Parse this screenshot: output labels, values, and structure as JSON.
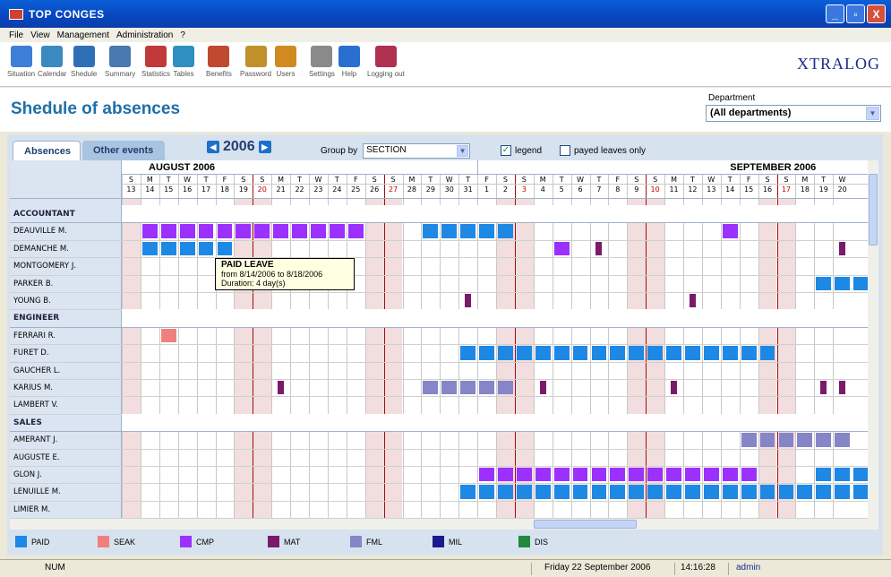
{
  "window": {
    "title": "TOP CONGES",
    "btn_min": "_",
    "btn_max": "▫",
    "btn_close": "X"
  },
  "menu": [
    "File",
    "View",
    "Management",
    "Administration",
    "?"
  ],
  "toolbar": [
    {
      "label": "Situation",
      "icon": "situation-icon",
      "color": "#3d7fd6"
    },
    {
      "label": "Calendar",
      "icon": "calendar-icon",
      "color": "#3a8ac0"
    },
    {
      "label": "Shedule",
      "icon": "schedule-icon",
      "color": "#2f6fb8"
    },
    {
      "label": "Summary",
      "icon": "summary-icon",
      "color": "#4a78b0"
    },
    {
      "label": "Statistics",
      "icon": "statistics-icon",
      "color": "#c03a3a"
    },
    {
      "label": "Tables",
      "icon": "tables-icon",
      "color": "#2f8fc0"
    },
    {
      "label": "Benefits",
      "icon": "benefits-icon",
      "color": "#c04a30"
    },
    {
      "label": "Password",
      "icon": "password-icon",
      "color": "#c0902a"
    },
    {
      "label": "Users",
      "icon": "users-icon",
      "color": "#d08a20"
    },
    {
      "label": "Settings",
      "icon": "settings-icon",
      "color": "#8a8a8a"
    },
    {
      "label": "Help",
      "icon": "help-icon",
      "color": "#2a6fd0"
    },
    {
      "label": "Logging out",
      "icon": "logout-icon",
      "color": "#b03050"
    }
  ],
  "brand": "XTRALOG",
  "page_title": "Shedule of absences",
  "department": {
    "label": "Department",
    "value": "(All departments)"
  },
  "tabs": [
    "Absences",
    "Other events"
  ],
  "year": "2006",
  "group_by": {
    "label": "Group by",
    "value": "SECTION"
  },
  "legend_checkbox": {
    "label": "legend",
    "checked": true
  },
  "payed_checkbox": {
    "label": "payed leaves only",
    "checked": false
  },
  "months": [
    {
      "name": "AUGUST",
      "year": "2006"
    },
    {
      "name": "SEPTEMBER",
      "year": "2006"
    }
  ],
  "days": [
    {
      "d": "S",
      "n": "13",
      "we": true
    },
    {
      "d": "M",
      "n": "14"
    },
    {
      "d": "T",
      "n": "15"
    },
    {
      "d": "W",
      "n": "16"
    },
    {
      "d": "T",
      "n": "17"
    },
    {
      "d": "F",
      "n": "18"
    },
    {
      "d": "S",
      "n": "19",
      "we": true
    },
    {
      "d": "S",
      "n": "20",
      "we": true,
      "red": true
    },
    {
      "d": "M",
      "n": "21"
    },
    {
      "d": "T",
      "n": "22"
    },
    {
      "d": "W",
      "n": "23"
    },
    {
      "d": "T",
      "n": "24"
    },
    {
      "d": "F",
      "n": "25"
    },
    {
      "d": "S",
      "n": "26",
      "we": true
    },
    {
      "d": "S",
      "n": "27",
      "we": true,
      "red": true
    },
    {
      "d": "M",
      "n": "28"
    },
    {
      "d": "T",
      "n": "29"
    },
    {
      "d": "W",
      "n": "30"
    },
    {
      "d": "T",
      "n": "31"
    },
    {
      "d": "F",
      "n": "1",
      "monthstart": true
    },
    {
      "d": "S",
      "n": "2",
      "we": true
    },
    {
      "d": "S",
      "n": "3",
      "we": true,
      "red": true
    },
    {
      "d": "M",
      "n": "4"
    },
    {
      "d": "T",
      "n": "5"
    },
    {
      "d": "W",
      "n": "6"
    },
    {
      "d": "T",
      "n": "7"
    },
    {
      "d": "F",
      "n": "8"
    },
    {
      "d": "S",
      "n": "9",
      "we": true
    },
    {
      "d": "S",
      "n": "10",
      "we": true,
      "red": true
    },
    {
      "d": "M",
      "n": "11"
    },
    {
      "d": "T",
      "n": "12"
    },
    {
      "d": "W",
      "n": "13"
    },
    {
      "d": "T",
      "n": "14"
    },
    {
      "d": "F",
      "n": "15"
    },
    {
      "d": "S",
      "n": "16",
      "we": true
    },
    {
      "d": "S",
      "n": "17",
      "we": true,
      "red": true
    },
    {
      "d": "M",
      "n": "18"
    },
    {
      "d": "T",
      "n": "19"
    },
    {
      "d": "W",
      "n": "20"
    }
  ],
  "rows": [
    {
      "type": "section",
      "name": "ACCOUNTANT"
    },
    {
      "type": "emp",
      "name": "DEAUVILLE M.",
      "abs": [
        {
          "t": "CMP",
          "from": 1,
          "to": 12
        },
        {
          "t": "PAID",
          "from": 16,
          "to": 20
        },
        {
          "t": "CMP",
          "from": 32,
          "to": 32
        }
      ]
    },
    {
      "type": "emp",
      "name": "DEMANCHE M.",
      "abs": [
        {
          "t": "PAID",
          "from": 1,
          "to": 5
        },
        {
          "t": "CMP",
          "from": 23,
          "to": 23
        },
        {
          "t": "MAT",
          "from": 25,
          "to": 25,
          "thin": true
        },
        {
          "t": "MAT",
          "from": 38,
          "to": 38,
          "thin": true
        }
      ]
    },
    {
      "type": "emp",
      "name": "MONTGOMERY J.",
      "abs": []
    },
    {
      "type": "emp",
      "name": "PARKER B.",
      "abs": [
        {
          "t": "PAID",
          "from": 37,
          "to": 39
        }
      ]
    },
    {
      "type": "emp",
      "name": "YOUNG B.",
      "abs": [
        {
          "t": "MAT",
          "from": 18,
          "to": 18,
          "thin": true
        },
        {
          "t": "MAT",
          "from": 30,
          "to": 30,
          "thin": true
        }
      ]
    },
    {
      "type": "section",
      "name": "ENGINEER"
    },
    {
      "type": "emp",
      "name": "FERRARI R.",
      "abs": [
        {
          "t": "SEAK",
          "from": 2,
          "to": 2
        }
      ]
    },
    {
      "type": "emp",
      "name": "FURET D.",
      "abs": [
        {
          "t": "PAID",
          "from": 18,
          "to": 34
        }
      ]
    },
    {
      "type": "emp",
      "name": "GAUCHER L.",
      "abs": []
    },
    {
      "type": "emp",
      "name": "KARIUS M.",
      "abs": [
        {
          "t": "MAT",
          "from": 8,
          "to": 8,
          "thin": true
        },
        {
          "t": "FML",
          "from": 16,
          "to": 20
        },
        {
          "t": "MAT",
          "from": 22,
          "to": 22,
          "thin": true
        },
        {
          "t": "MAT",
          "from": 29,
          "to": 29,
          "thin": true
        },
        {
          "t": "MAT",
          "from": 37,
          "to": 37,
          "thin": true
        },
        {
          "t": "MAT",
          "from": 38,
          "to": 38,
          "thin": true
        }
      ]
    },
    {
      "type": "emp",
      "name": "LAMBERT V.",
      "abs": []
    },
    {
      "type": "section",
      "name": "SALES"
    },
    {
      "type": "emp",
      "name": "AMERANT J.",
      "abs": [
        {
          "t": "FML",
          "from": 33,
          "to": 38
        }
      ]
    },
    {
      "type": "emp",
      "name": "AUGUSTE E.",
      "abs": []
    },
    {
      "type": "emp",
      "name": "GLON J.",
      "abs": [
        {
          "t": "CMP",
          "from": 19,
          "to": 33
        },
        {
          "t": "PAID",
          "from": 37,
          "to": 39
        }
      ]
    },
    {
      "type": "emp",
      "name": "LENUILLE M.",
      "abs": [
        {
          "t": "PAID",
          "from": 18,
          "to": 39
        }
      ]
    },
    {
      "type": "emp",
      "name": "LIMIER M.",
      "abs": []
    }
  ],
  "tooltip": {
    "title": "PAID LEAVE",
    "line1": "from 8/14/2006 to 8/18/2006",
    "line2": "Duration: 4 day(s)"
  },
  "legend": [
    {
      "code": "PAID",
      "color": "#1e88e5"
    },
    {
      "code": "SEAK",
      "color": "#f08080"
    },
    {
      "code": "CMP",
      "color": "#9b30ff"
    },
    {
      "code": "MAT",
      "color": "#7b1a6a"
    },
    {
      "code": "FML",
      "color": "#8585c8"
    },
    {
      "code": "MIL",
      "color": "#1a1a8c"
    },
    {
      "code": "DIS",
      "color": "#1f8a3a"
    }
  ],
  "status": {
    "mode": "NUM",
    "date": "Friday 22 September 2006",
    "time": "14:16:28",
    "user": "admin"
  }
}
